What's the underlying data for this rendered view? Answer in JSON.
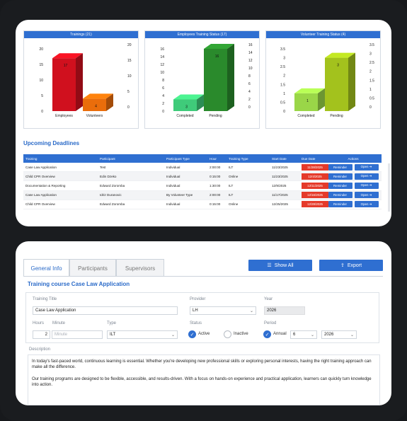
{
  "charts": [
    {
      "title": "Trainings (21)",
      "type": "bar3d",
      "categories": [
        "Employees",
        "Volunteers"
      ],
      "values": [
        17,
        4
      ],
      "colors": [
        "#d0101e",
        "#ea6d0b"
      ],
      "left_ticks": [
        "0",
        "5",
        "10",
        "15",
        "20"
      ],
      "right_ticks": [
        "0",
        "5",
        "10",
        "15",
        "20"
      ],
      "ymax": 20
    },
    {
      "title": "Employees Training Status (17)",
      "type": "bar3d",
      "categories": [
        "Completed",
        "Pending"
      ],
      "values": [
        3,
        16
      ],
      "colors": [
        "#3fcb7a",
        "#2a8a2c"
      ],
      "left_ticks": [
        "0",
        "2",
        "4",
        "6",
        "8",
        "10",
        "12",
        "14",
        "16"
      ],
      "right_ticks": [
        "0",
        "2",
        "4",
        "6",
        "8",
        "10",
        "12",
        "14",
        "16"
      ],
      "ymax": 16
    },
    {
      "title": "Volunteer Training Status (4)",
      "type": "bar3d",
      "categories": [
        "Completed",
        "Pending"
      ],
      "values": [
        1,
        3
      ],
      "colors": [
        "#9ad648",
        "#a3c21d"
      ],
      "left_ticks": [
        "0",
        "0.5",
        "1",
        "1.5",
        "2",
        "2.5",
        "3",
        "3.5"
      ],
      "right_ticks": [
        "0",
        "0.5",
        "1",
        "1.5",
        "2",
        "2.5",
        "3",
        "3.5"
      ],
      "ymax": 3.5
    }
  ],
  "chart_data": [
    {
      "type": "bar",
      "title": "Trainings (21)",
      "categories": [
        "Employees",
        "Volunteers"
      ],
      "values": [
        17,
        4
      ],
      "ylim": [
        0,
        20
      ]
    },
    {
      "type": "bar",
      "title": "Employees Training Status (17)",
      "categories": [
        "Completed",
        "Pending"
      ],
      "values": [
        3,
        16
      ],
      "ylim": [
        0,
        16
      ]
    },
    {
      "type": "bar",
      "title": "Volunteer Training Status (4)",
      "categories": [
        "Completed",
        "Pending"
      ],
      "values": [
        1,
        3
      ],
      "ylim": [
        0,
        3.5
      ]
    }
  ],
  "deadlines": {
    "title": "Upcoming Deadlines",
    "columns": [
      "Training",
      "Participant",
      "Participant Type",
      "Hour",
      "Training Type",
      "Start Date",
      "Due Date",
      "Actions"
    ],
    "rows": [
      [
        "Case Law Application",
        "Test",
        "Individual",
        "2:00:00",
        "ILT",
        "11/23/2025",
        "11/28/2025"
      ],
      [
        "Child CPR Overview",
        "Edin Dzeko",
        "Individual",
        "0:15:00",
        "Online",
        "11/23/2025",
        "12/4/2025"
      ],
      [
        "Documentation & Reporting",
        "Edward Zoromba",
        "Individual",
        "1:30:00",
        "ILT",
        "12/9/2025",
        "12/11/2025"
      ],
      [
        "Case Law Application",
        "Idriz Duranovic",
        "By Volunteer Type",
        "2:00:00",
        "ILT",
        "11/17/2025",
        "12/16/2025"
      ],
      [
        "Child CPR Overview",
        "Edward Zoromba",
        "Individual",
        "0:15:00",
        "Online",
        "12/25/2025",
        "12/28/2025"
      ]
    ],
    "reminder_label": "Reminder",
    "open_label": "Open ➔"
  },
  "detail": {
    "tabs": [
      "General Info",
      "Participants",
      "Supervisors"
    ],
    "show_all_label": "Show All",
    "export_label": "Export",
    "form_title": "Training course Case Law Application",
    "training_title_label": "Training Title",
    "training_title_value": "Case Law Application",
    "provider_label": "Provider",
    "provider_value": "LH",
    "year_label": "Year",
    "year_value": "2026",
    "hours_label": "Hours",
    "hours_value": "2",
    "minute_label": "Minute",
    "minute_placeholder": "Minute",
    "type_label": "Type",
    "type_value": "ILT",
    "status_label": "Status",
    "status_active": "Active",
    "status_inactive": "Inactive",
    "period_label": "Period",
    "period_annual": "Annual",
    "period_month": "6",
    "period_year": "2026",
    "description_label": "Description",
    "description_p1": "In today's fast-paced world, continuous learning is essential. Whether you're developing new professional skills or exploring personal interests, having the right training approach can make all the difference.",
    "description_p2": "Our training programs are designed to be flexible, accessible, and results-driven. With a focus on hands-on experience and practical application, learners can quickly turn knowledge into action."
  }
}
